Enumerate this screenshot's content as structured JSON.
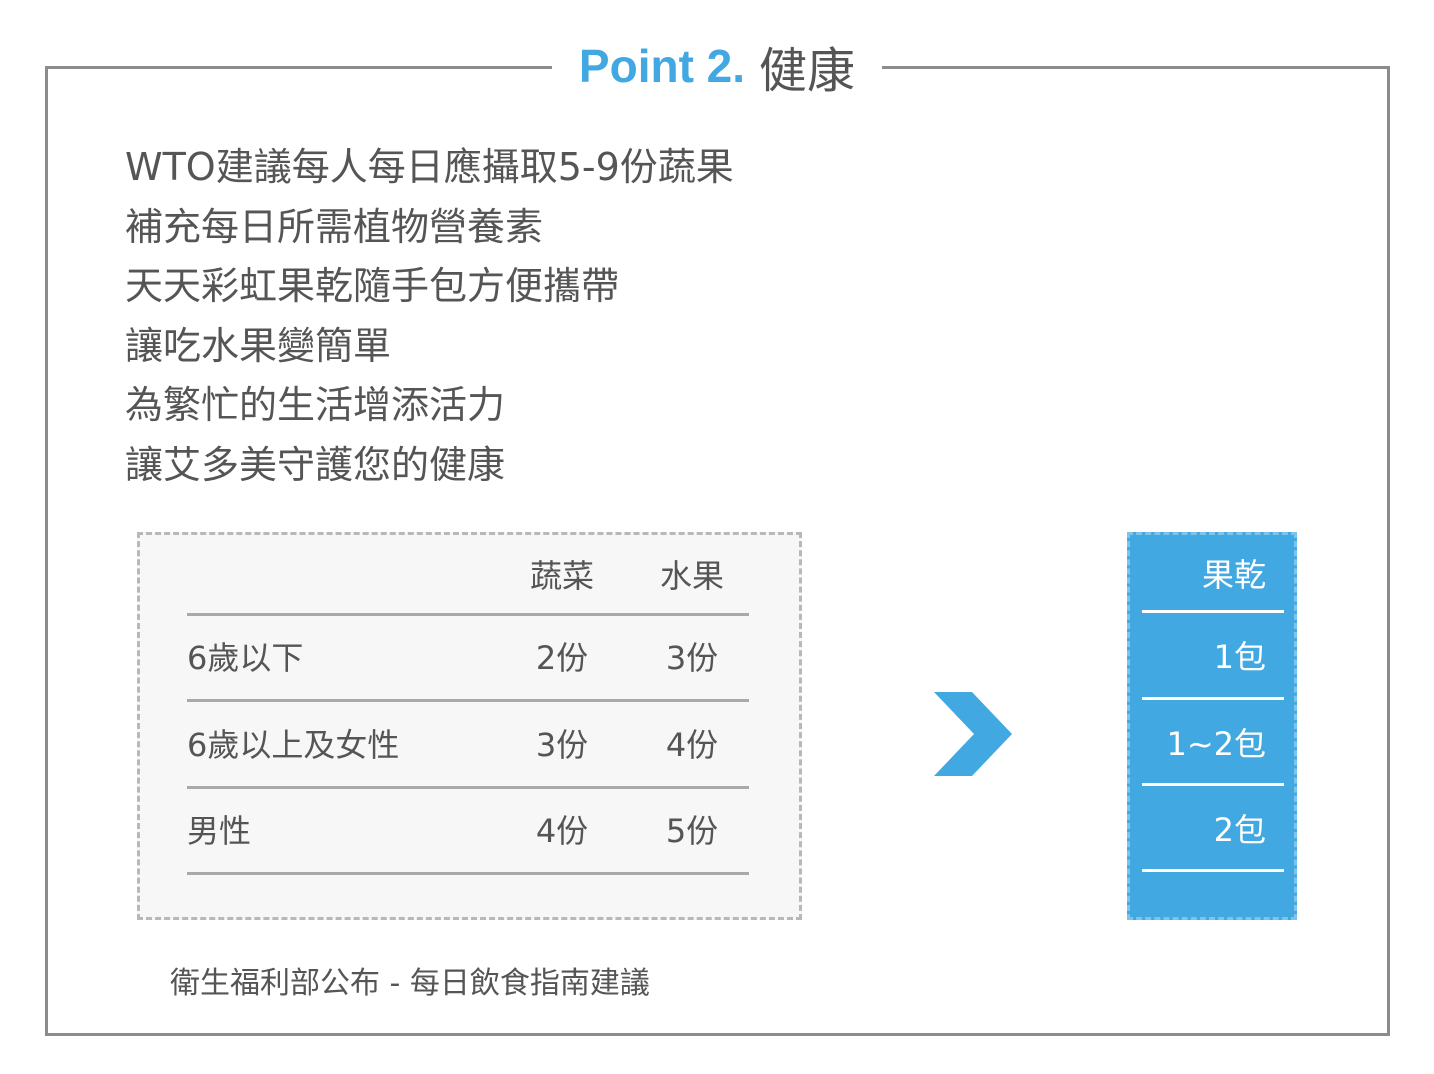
{
  "colors": {
    "accent": "#42a8e2",
    "text": "#555555",
    "frame": "#8c8c8c"
  },
  "title": {
    "point": "Point 2.",
    "label": "健康"
  },
  "intro_lines": [
    "WTO建議每人每日應攝取5-9份蔬果",
    "補充每日所需植物營養素",
    "天天彩虹果乾隨手包方便攜帶",
    "讓吃水果變簡單",
    "為繁忙的生活增添活力",
    "讓艾多美守護您的健康"
  ],
  "table": {
    "headers": [
      "",
      "蔬菜",
      "水果"
    ],
    "rows": [
      [
        "6歲以下",
        "2份",
        "3份"
      ],
      [
        "6歲以上及女性",
        "3份",
        "4份"
      ],
      [
        "男性",
        "4份",
        "5份"
      ]
    ]
  },
  "arrow_icon": "chevron-right-icon",
  "dried_fruit": {
    "header": "果乾",
    "values": [
      "1包",
      "1~2包",
      "2包"
    ]
  },
  "source": "衛生福利部公布 - 每日飲食指南建議"
}
